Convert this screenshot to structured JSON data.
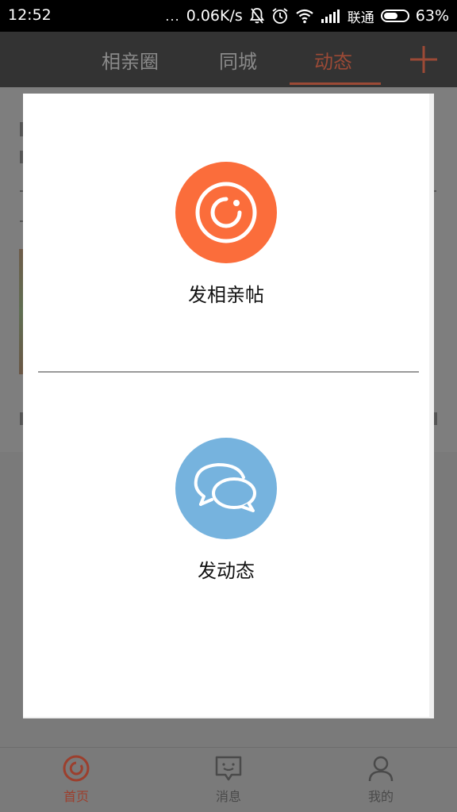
{
  "status_bar": {
    "time": "12:52",
    "dots": "...",
    "network_speed": "0.06K/s",
    "carrier": "联通",
    "battery_percent": "63%",
    "battery_level": 0.63
  },
  "nav": {
    "tabs": [
      {
        "label": "相亲圈",
        "active": false
      },
      {
        "label": "同城",
        "active": false
      },
      {
        "label": "动态",
        "active": true
      }
    ],
    "add_icon": "plus-icon"
  },
  "dialog": {
    "options": [
      {
        "label": "发相亲帖",
        "icon": "camera-ring-icon",
        "color": "#fb6d3b"
      },
      {
        "label": "发动态",
        "icon": "chat-bubbles-icon",
        "color": "#76b3de"
      }
    ]
  },
  "bottom_tabs": [
    {
      "label": "首页",
      "icon": "home-ring-icon",
      "active": true
    },
    {
      "label": "消息",
      "icon": "message-face-icon",
      "active": false
    },
    {
      "label": "我的",
      "icon": "user-icon",
      "active": false
    }
  ],
  "colors": {
    "accent": "#fb6d3b",
    "secondary": "#76b3de",
    "nav_background": "#333333",
    "overlay_dim": "#7e7e7e"
  }
}
